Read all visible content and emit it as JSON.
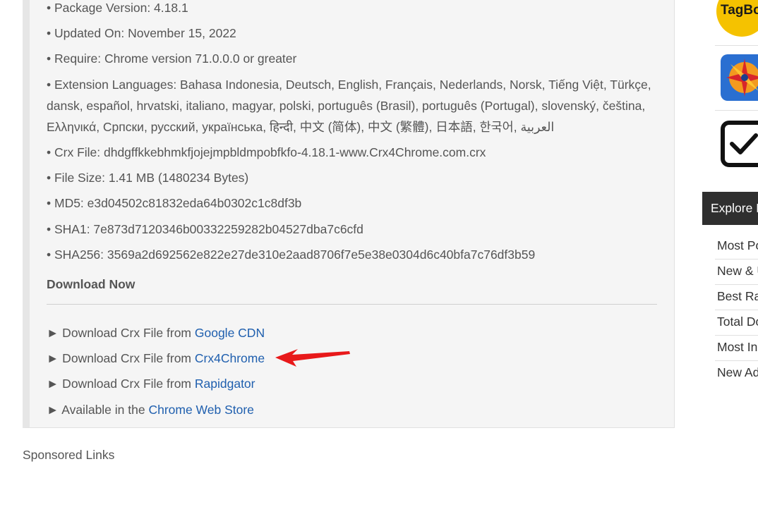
{
  "details": [
    "• Package Version: 4.18.1",
    "• Updated On: November 15, 2022",
    "• Require: Chrome version 71.0.0.0 or greater",
    "• Extension Languages: Bahasa Indonesia, Deutsch, English, Français, Nederlands, Norsk, Tiếng Việt, Türkçe, dansk, español, hrvatski, italiano, magyar, polski, português (Brasil), português (Portugal), slovenský, čeština, Ελληνικά, Српски, русский, українська, हिन्दी, 中文 (简体), 中文 (繁體), 日本語, 한국어, العربية",
    "• Crx File: dhdgffkkebhmkfjojejmpbldmpobfkfo-4.18.1-www.Crx4Chrome.com.crx",
    "• File Size: 1.41 MB (1480234 Bytes)",
    "• MD5: e3d04502c81832eda64b0302c1c8df3b",
    "• SHA1: 7e873d7120346b00332259282b04527dba7c6cfd",
    "• SHA256: 3569a2d692562e822e27de310e2aad8706f7e5e38e0304d6c40bfa7c76df3b59"
  ],
  "download": {
    "heading": "Download Now",
    "links": [
      {
        "prefix": "► Download Crx File from ",
        "link_text": "Google CDN"
      },
      {
        "prefix": "► Download Crx File from ",
        "link_text": "Crx4Chrome"
      },
      {
        "prefix": "► Download Crx File from ",
        "link_text": "Rapidgator"
      },
      {
        "prefix": "► Available in the ",
        "link_text": "Chrome Web Store"
      }
    ]
  },
  "annotation": {
    "arrow_color": "#e8191a"
  },
  "sponsored": "Sponsored Links",
  "sidebar": {
    "icons": [
      {
        "name": "tagbox-app-icon",
        "text": "TagBo"
      },
      {
        "name": "compass-star-app-icon"
      },
      {
        "name": "checkbox-app-icon"
      }
    ],
    "explore_title": "Explore E",
    "explore_items": [
      "Most Po",
      "New & U",
      "Best Ra",
      "Total Do",
      "Most In",
      "New Ad"
    ]
  },
  "colors": {
    "link": "#1f5fae",
    "text": "#555555",
    "box_bg": "#f5f5f5",
    "explore_bg": "#2f2f2f"
  }
}
